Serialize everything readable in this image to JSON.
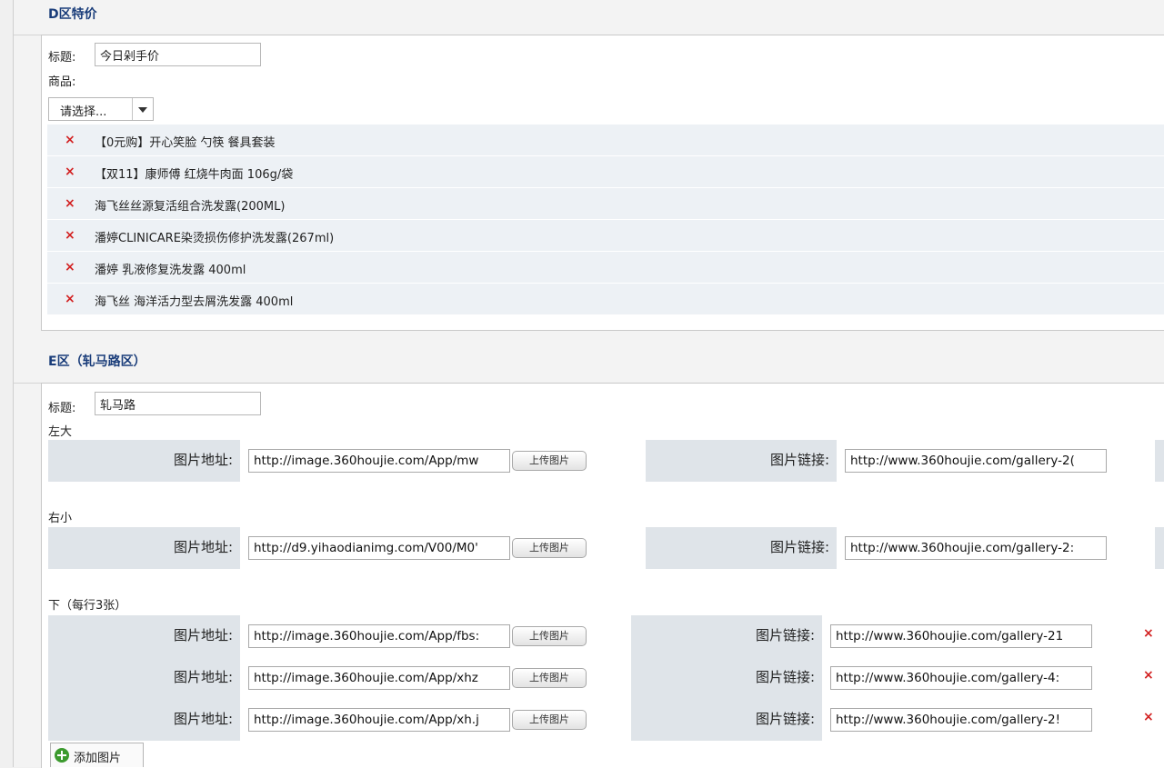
{
  "section_d": {
    "title": "D区特价",
    "title_label": "标题:",
    "title_value": "今日剁手价",
    "goods_label": "商品:",
    "select_value": "请选择...",
    "delete_glyph": "×",
    "products": [
      "【0元购】开心笑脸 勺筷 餐具套装",
      "【双11】康师傅 红烧牛肉面 106g/袋",
      "海飞丝丝源复活组合洗发露(200ML)",
      "潘婷CLINICARE染烫损伤修护洗发露(267ml)",
      "潘婷 乳液修复洗发露 400ml",
      "海飞丝 海洋活力型去屑洗发露 400ml"
    ]
  },
  "section_e": {
    "title": "E区（轧马路区）",
    "title_label": "标题:",
    "title_value": "轧马路",
    "img_addr_label": "图片地址:",
    "img_link_label": "图片链接:",
    "upload_label": "上传图片",
    "delete_glyph": "×",
    "left_big": {
      "label": "左大",
      "addr": "http://image.360houjie.com/App/mw",
      "link": "http://www.360houjie.com/gallery-2("
    },
    "right_small": {
      "label": "右小",
      "addr": "http://d9.yihaodianimg.com/V00/M0'",
      "link": "http://www.360houjie.com/gallery-2:"
    },
    "bottom": {
      "label": "下（每行3张）",
      "rows": [
        {
          "addr": "http://image.360houjie.com/App/fbs:",
          "link": "http://www.360houjie.com/gallery-21"
        },
        {
          "addr": "http://image.360houjie.com/App/xhz",
          "link": "http://www.360houjie.com/gallery-4:"
        },
        {
          "addr": "http://image.360houjie.com/App/xh.j",
          "link": "http://www.360houjie.com/gallery-2!"
        }
      ]
    },
    "add_image_label": "添加图片"
  }
}
